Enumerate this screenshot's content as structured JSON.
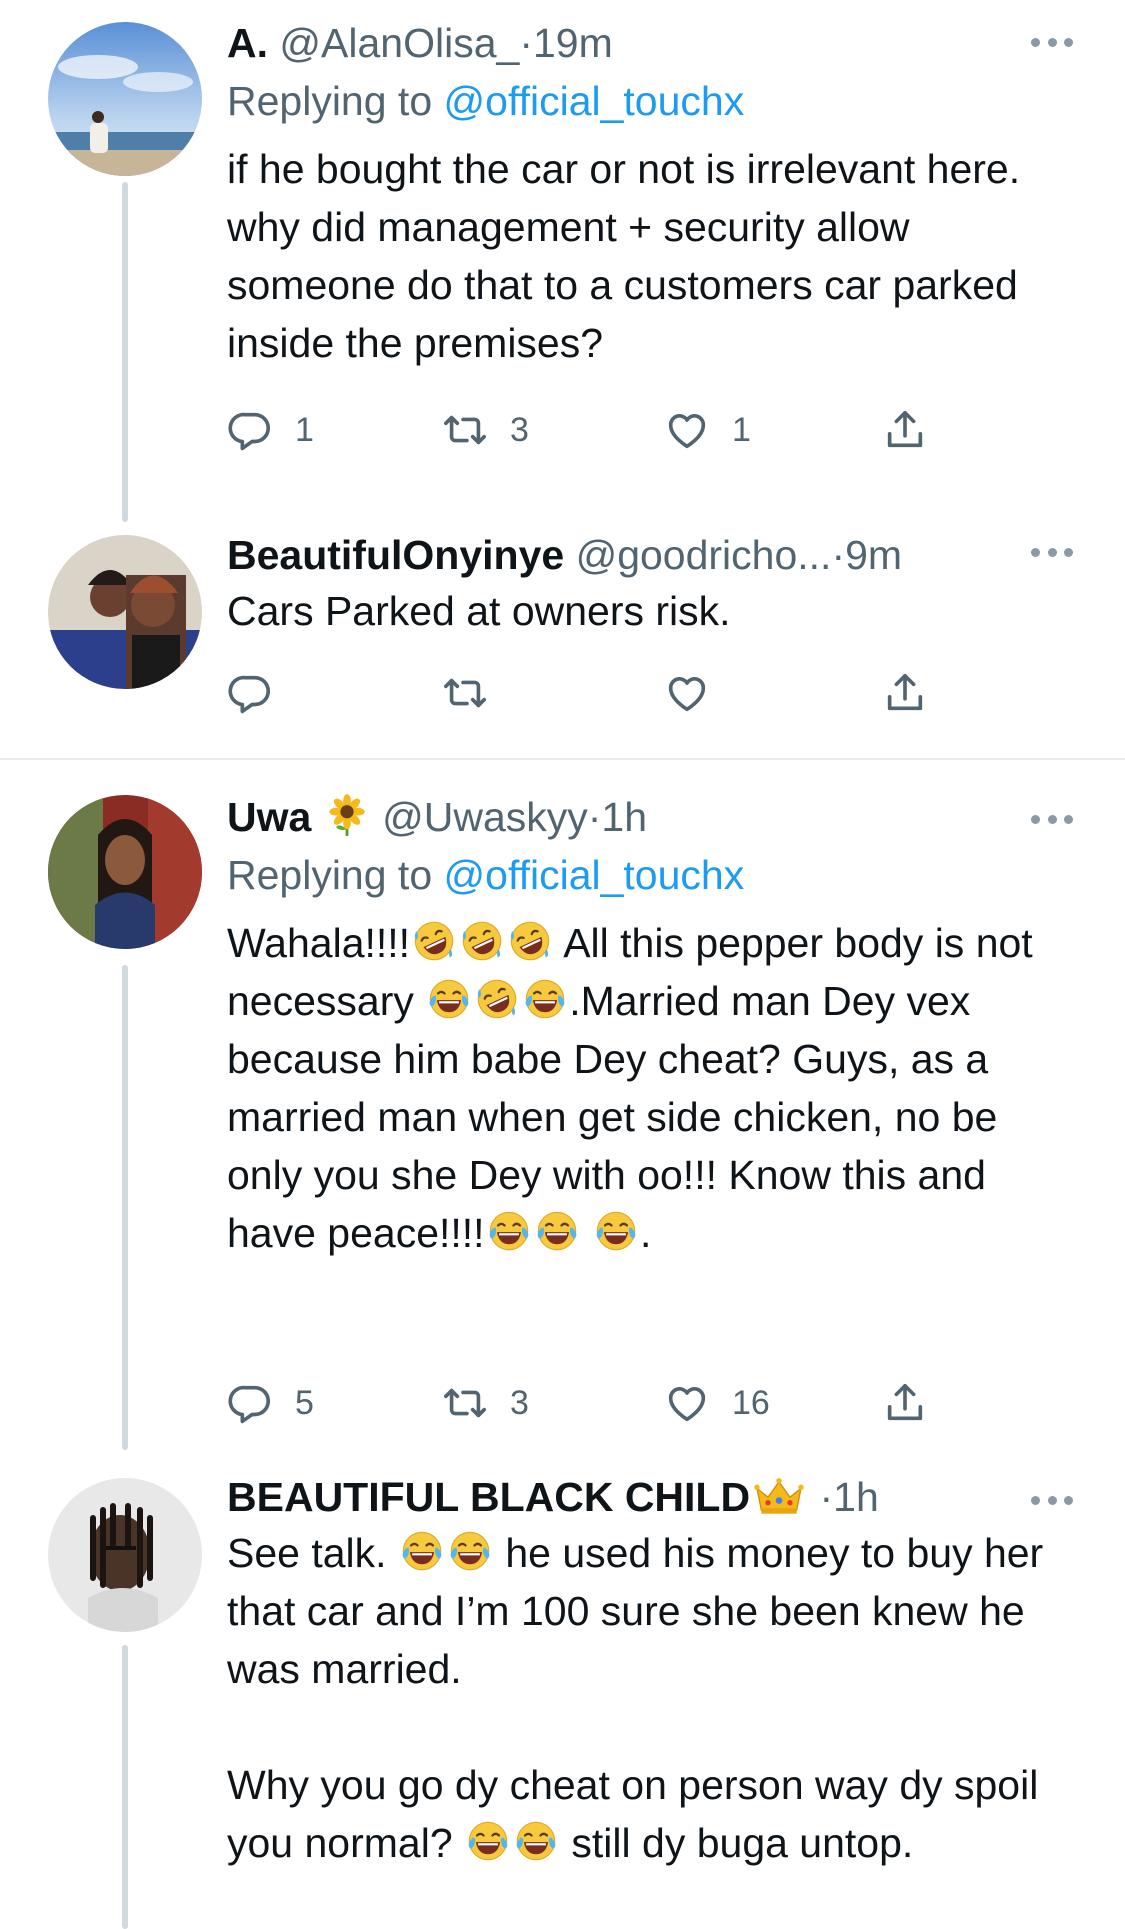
{
  "tweets": [
    {
      "name": "A.",
      "handle": "@AlanOlisa_",
      "time": "19m",
      "replying_prefix": "Replying to ",
      "replying_to": "@official_touchx",
      "text": "if he bought the car or not is irrelevant here. why did management + security allow someone do that to a customers car parked inside the premises?",
      "reply_count": "1",
      "retweet_count": "3",
      "like_count": "1"
    },
    {
      "name": "BeautifulOnyinye",
      "handle": "@goodricho...",
      "time": "9m",
      "text": "Cars Parked at owners risk.",
      "reply_count": "",
      "retweet_count": "",
      "like_count": ""
    },
    {
      "name": "Uwa",
      "name_emoji": "sunflower-emoji",
      "handle": "@Uwaskyy",
      "time": "1h",
      "replying_prefix": "Replying to ",
      "replying_to": "@official_touchx",
      "text_parts": [
        "Wahala!!!!",
        " All this pepper body is not necessary ",
        ".Married man Dey vex because him babe Dey cheat? Guys, as a married man when get side chicken, no be only you she Dey with oo!!! Know this and have peace!!!!",
        "."
      ],
      "reply_count": "5",
      "retweet_count": "3",
      "like_count": "16"
    },
    {
      "name": "BEAUTIFUL BLACK CHILD",
      "name_emoji": "crown-emoji",
      "time": "1h",
      "text_parts": [
        "See talk. ",
        " he used his money to buy her that car and I’m 100 sure she been knew he was married.",
        "Why you go dy cheat on person way dy spoil you normal? ",
        " still dy buga untop."
      ]
    }
  ],
  "separator": "·",
  "colors": {
    "link": "#1d9bf0",
    "secondary": "#536471",
    "thread_line": "#cfd9de",
    "divider": "#e6ecf0"
  },
  "icons": [
    "reply-icon",
    "retweet-icon",
    "like-icon",
    "share-icon",
    "more-icon",
    "rolling-laughing-emoji",
    "tears-of-joy-emoji"
  ]
}
